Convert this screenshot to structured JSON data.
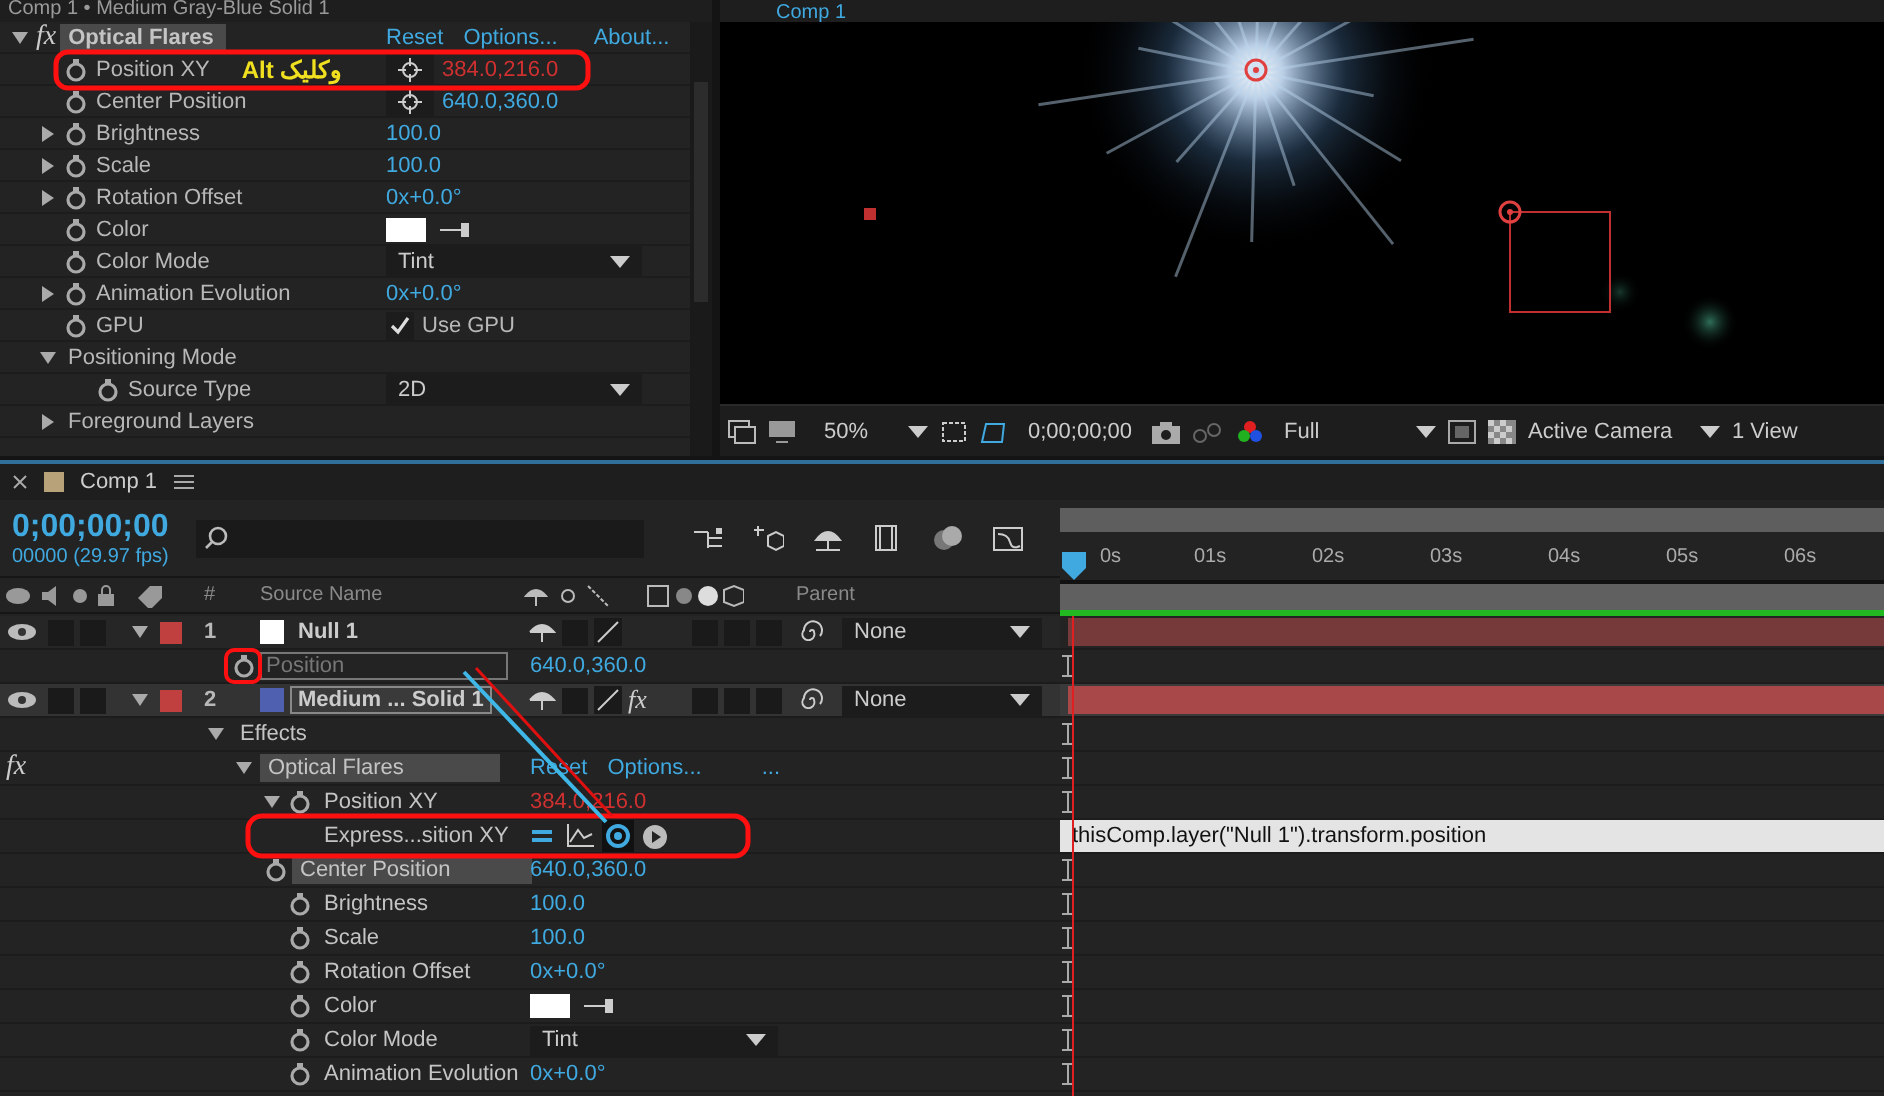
{
  "effect_controls": {
    "title": "Comp 1 • Medium Gray-Blue Solid 1",
    "fx_label": "fx",
    "effect": "Optical Flares",
    "links": [
      "Reset",
      "Options...",
      "About..."
    ],
    "properties": [
      {
        "kind": "point",
        "label": "Position XY",
        "value": "384.0,216.0",
        "expression": true,
        "note": "Alt وکلیک"
      },
      {
        "kind": "point",
        "label": "Center Position",
        "value": "640.0,360.0",
        "expression": false
      },
      {
        "kind": "number",
        "label": "Brightness",
        "value": "100.0",
        "expanded": false
      },
      {
        "kind": "number",
        "label": "Scale",
        "value": "100.0",
        "expanded": false
      },
      {
        "kind": "number",
        "label": "Rotation Offset",
        "value": "0x+0.0°",
        "expanded": false
      },
      {
        "kind": "color",
        "label": "Color",
        "color": "#ffffff"
      },
      {
        "kind": "select",
        "label": "Color Mode",
        "value": "Tint"
      },
      {
        "kind": "number",
        "label": "Animation Evolution",
        "value": "0x+0.0°",
        "expanded": false
      },
      {
        "kind": "checkbox",
        "label": "GPU",
        "value": "Use GPU",
        "checked": true
      },
      {
        "kind": "group",
        "label": "Positioning Mode",
        "expanded": true,
        "children": [
          {
            "kind": "select",
            "label": "Source Type",
            "value": "2D"
          }
        ]
      },
      {
        "kind": "group",
        "label": "Foreground Layers",
        "expanded": false
      }
    ]
  },
  "viewer": {
    "tab": "Comp 1",
    "zoom": "50%",
    "timecode": "0;00;00;00",
    "resolution": "Full",
    "camera": "Active Camera",
    "views": "1 View"
  },
  "timeline": {
    "tab": "Comp 1",
    "timecode": "0;00;00;00",
    "frame_info": "00000 (29.97 fps)",
    "columns": [
      "#",
      "Source Name",
      "Parent"
    ],
    "ruler": [
      "0s",
      "01s",
      "02s",
      "03s",
      "04s",
      "05s",
      "06s"
    ],
    "layers": [
      {
        "number": "1",
        "name": "Null 1",
        "color": "#ffffff",
        "parent": "None",
        "selected": false,
        "expanded": true,
        "children": [
          {
            "kind": "property",
            "label": "Position",
            "value": "640.0,360.0",
            "renaming": true
          }
        ]
      },
      {
        "number": "2",
        "name": "Medium ... Solid 1",
        "color": "#5060b0",
        "parent": "None",
        "selected": true,
        "expanded": true,
        "fx_switch": "fx",
        "fx_active": true,
        "children": [
          {
            "kind": "group",
            "label": "Effects",
            "expanded": true,
            "selected": false,
            "children": [
              {
                "kind": "effect",
                "fx_label": "fx",
                "label": "Optical Flares",
                "links": [
                  "Reset",
                  "Options...",
                  "..."
                ],
                "expanded": true,
                "selected": true,
                "children": [
                  {
                    "kind": "point",
                    "label": "Position XY",
                    "value": "384.0,216.0",
                    "expression": true,
                    "expanded": true,
                    "selected": false,
                    "children": [
                      {
                        "kind": "expression",
                        "label": "Express...sition XY",
                        "text": "thisComp.layer(\"Null 1\").transform.position",
                        "selected": false
                      }
                    ]
                  },
                  {
                    "kind": "point",
                    "label": "Center Position",
                    "value": "640.0,360.0",
                    "expression": false,
                    "selected": true
                  },
                  {
                    "kind": "number",
                    "label": "Brightness",
                    "value": "100.0",
                    "selected": false
                  },
                  {
                    "kind": "number",
                    "label": "Scale",
                    "value": "100.0",
                    "selected": false
                  },
                  {
                    "kind": "number",
                    "label": "Rotation Offset",
                    "value": "0x+0.0°",
                    "selected": false
                  },
                  {
                    "kind": "color",
                    "label": "Color",
                    "color": "#ffffff",
                    "selected": false
                  },
                  {
                    "kind": "select",
                    "label": "Color Mode",
                    "value": "Tint",
                    "selected": false
                  },
                  {
                    "kind": "number",
                    "label": "Animation Evolution",
                    "value": "0x+0.0°",
                    "selected": false
                  }
                ]
              }
            ]
          }
        ]
      }
    ]
  }
}
